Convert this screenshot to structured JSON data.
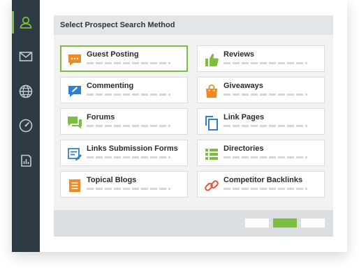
{
  "panel": {
    "title": "Select Prospect Search Method"
  },
  "methods": [
    {
      "label": "Guest Posting",
      "icon": "chat-bubble-icon",
      "color": "#f08a24"
    },
    {
      "label": "Reviews",
      "icon": "thumbs-up-icon",
      "color": "#7dbd3f"
    },
    {
      "label": "Commenting",
      "icon": "comment-edit-icon",
      "color": "#2f7fd1"
    },
    {
      "label": "Giveaways",
      "icon": "shopping-bag-icon",
      "color": "#f08a24"
    },
    {
      "label": "Forums",
      "icon": "forum-icon",
      "color": "#7dbd3f"
    },
    {
      "label": "Link Pages",
      "icon": "copy-pages-icon",
      "color": "#2f7fd1"
    },
    {
      "label": "Links Submission Forms",
      "icon": "form-edit-icon",
      "color": "#2f7fd1"
    },
    {
      "label": "Directories",
      "icon": "list-icon",
      "color": "#7dbd3f"
    },
    {
      "label": "Topical Blogs",
      "icon": "document-icon",
      "color": "#f08a24"
    },
    {
      "label": "Competitor Backlinks",
      "icon": "link-icon",
      "color": "#e8533a"
    }
  ],
  "selected_method": "Guest Posting",
  "colors": {
    "accent": "#7dbd3f",
    "sidebar": "#2e3a44"
  }
}
